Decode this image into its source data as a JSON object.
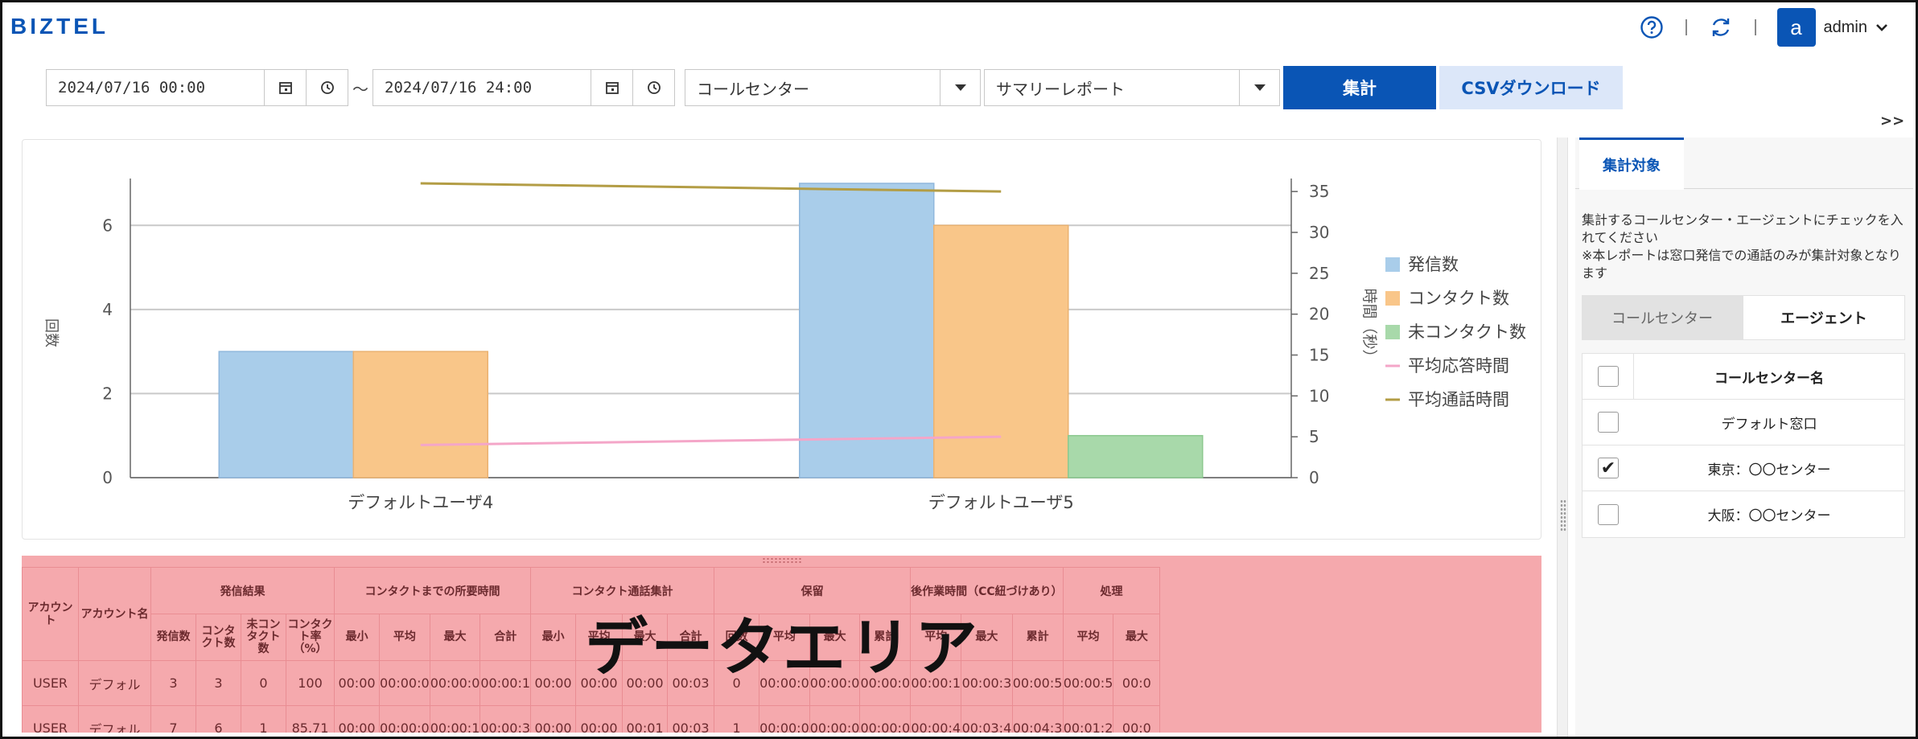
{
  "app": {
    "logo": "BIZTEL"
  },
  "header": {
    "help_icon": "question-circle-icon",
    "refresh_icon": "refresh-icon",
    "avatar_letter": "a",
    "username": "admin"
  },
  "filters": {
    "start": "2024/07/16 00:00",
    "end": "2024/07/16 24:00",
    "tilde": "～",
    "callcenter": "コールセンター",
    "report": "サマリーレポート",
    "aggregate_label": "集計",
    "csv_label": "CSVダウンロード",
    "expand_label": ">>"
  },
  "chart_data": {
    "type": "bar",
    "categories": [
      "デフォルトユーザ4",
      "デフォルトユーザ5"
    ],
    "series": [
      {
        "name": "発信数",
        "kind": "bar",
        "axis": "left",
        "color": "#a9cdea",
        "values": [
          3,
          7
        ]
      },
      {
        "name": "コンタクト数",
        "kind": "bar",
        "axis": "left",
        "color": "#f9c689",
        "values": [
          3,
          6
        ]
      },
      {
        "name": "未コンタクト数",
        "kind": "bar",
        "axis": "left",
        "color": "#a8d9aa",
        "values": [
          0,
          1
        ]
      },
      {
        "name": "平均応答時間",
        "kind": "line",
        "axis": "right",
        "color": "#f4a6c8",
        "values": [
          4,
          5
        ]
      },
      {
        "name": "平均通話時間",
        "kind": "line",
        "axis": "right",
        "color": "#b39d45",
        "values": [
          36,
          35
        ]
      }
    ],
    "ylabel": "回数",
    "y2label": "時間（秒）",
    "ylim": [
      0,
      7
    ],
    "y2lim": [
      0,
      36
    ],
    "yticks": [
      0,
      2,
      4,
      6
    ],
    "y2ticks": [
      0,
      5,
      10,
      15,
      20,
      25,
      30,
      35
    ],
    "grid": true,
    "legend": "right"
  },
  "table": {
    "col_account": "アカウント",
    "col_account_name": "アカウント名",
    "groups": [
      "発信結果",
      "コンタクトまでの所要時間",
      "コンタクト通話集計",
      "保留",
      "後作業時間（CC紐づけあり）",
      "処理"
    ],
    "subheaders": [
      "発信数",
      "コンタクト数",
      "未コンタクト数",
      "コンタクト率（%）",
      "最小",
      "平均",
      "最大",
      "合計",
      "最小",
      "平均",
      "最大",
      "合計",
      "回数",
      "平均",
      "最大",
      "累計",
      "平均",
      "最大",
      "累計",
      "平均",
      "最大"
    ],
    "rows": [
      [
        "USER",
        "デフォル",
        "3",
        "3",
        "0",
        "100",
        "00:00",
        "00:00:0",
        "00:00:0",
        "00:00:1",
        "00:00",
        "00:00",
        "00:00",
        "00:03",
        "0",
        "00:00:0",
        "00:00:0",
        "00:00:0",
        "00:00:1",
        "00:00:3",
        "00:00:5",
        "00:00:5",
        "00:0"
      ],
      [
        "USER",
        "デフォル",
        "7",
        "6",
        "1",
        "85.71",
        "00:00",
        "00:00:0",
        "00:00:1",
        "00:00:3",
        "00:00",
        "00:00",
        "00:01",
        "00:03",
        "1",
        "00:00:0",
        "00:00:0",
        "00:00:0",
        "00:00:4",
        "00:03:4",
        "00:04:3",
        "00:01:2",
        "00:0"
      ]
    ],
    "overlay_label": "データエリア"
  },
  "panel": {
    "tab": "集計対象",
    "description": "集計するコールセンター・エージェントにチェックを入れてください\n※本レポートは窓口発信での通話のみが集計対象となります",
    "seg_callcenter": "コールセンター",
    "seg_agent": "エージェント",
    "list_header": "コールセンター名",
    "items": [
      {
        "name": "デフォルト窓口",
        "checked": false
      },
      {
        "name": "東京：〇〇センター",
        "checked": true
      },
      {
        "name": "大阪：〇〇センター",
        "checked": false
      }
    ]
  }
}
